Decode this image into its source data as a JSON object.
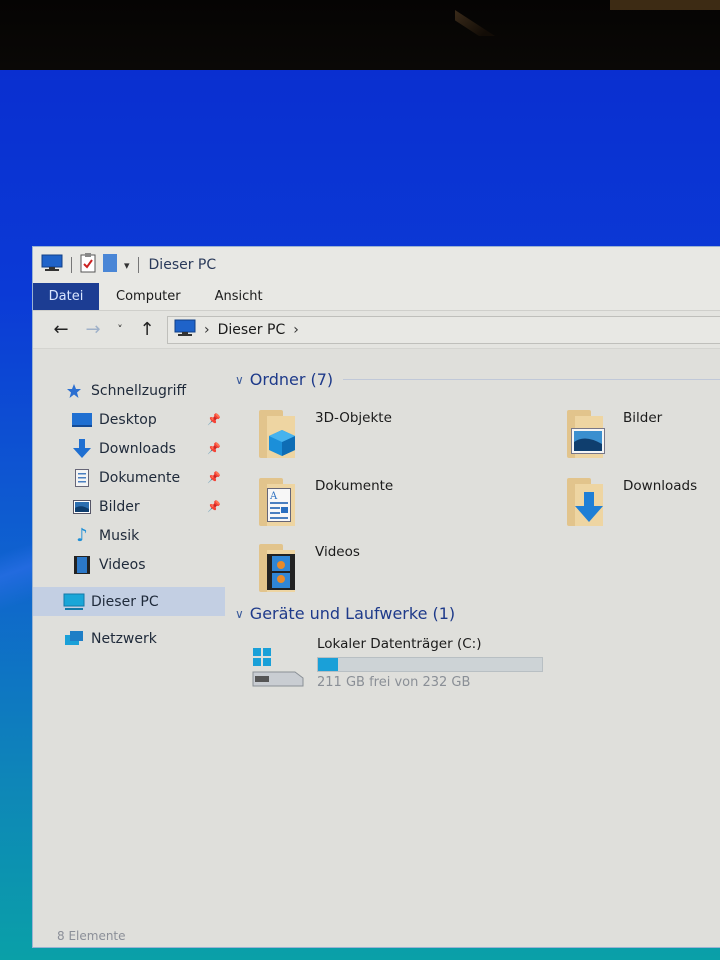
{
  "window": {
    "title": "Dieser PC",
    "quick_access_toolbar": [
      "computer-icon",
      "properties-icon",
      "new-folder-icon",
      "customize-dropdown-icon"
    ]
  },
  "ribbon": {
    "tabs": [
      {
        "label": "Datei",
        "active": true
      },
      {
        "label": "Computer",
        "active": false
      },
      {
        "label": "Ansicht",
        "active": false
      }
    ]
  },
  "address_bar": {
    "back": "←",
    "forward": "→",
    "recent": "˅",
    "up": "↑",
    "path": [
      "Dieser PC"
    ]
  },
  "nav_pane": {
    "quick_access": {
      "label": "Schnellzugriff",
      "icon": "star-icon"
    },
    "items": [
      {
        "label": "Desktop",
        "icon": "desktop-icon",
        "pinned": true
      },
      {
        "label": "Downloads",
        "icon": "download-icon",
        "pinned": true
      },
      {
        "label": "Dokumente",
        "icon": "document-icon",
        "pinned": true
      },
      {
        "label": "Bilder",
        "icon": "pictures-icon",
        "pinned": true
      },
      {
        "label": "Musik",
        "icon": "music-icon",
        "pinned": false
      },
      {
        "label": "Videos",
        "icon": "videos-icon",
        "pinned": false
      }
    ],
    "this_pc": {
      "label": "Dieser PC",
      "icon": "computer-icon",
      "selected": true
    },
    "network": {
      "label": "Netzwerk",
      "icon": "network-icon"
    }
  },
  "main": {
    "folders_group": {
      "title": "Ordner (7)",
      "items": [
        {
          "label": "3D-Objekte",
          "overlay": "cube-icon"
        },
        {
          "label": "Bilder",
          "overlay": "picture-icon"
        },
        {
          "label": "Dokumente",
          "overlay": "document-icon"
        },
        {
          "label": "Downloads",
          "overlay": "download-arrow-icon"
        },
        {
          "label": "Videos",
          "overlay": "film-icon"
        }
      ]
    },
    "drives_group": {
      "title": "Geräte und Laufwerke (1)",
      "items": [
        {
          "label": "Lokaler Datenträger (C:)",
          "free_text": "211 GB frei von 232 GB",
          "free_gb": 211,
          "total_gb": 232,
          "used_fraction": 0.09,
          "bar_color": "#1aa0d8"
        }
      ]
    }
  },
  "status_bar": {
    "text": "8 Elemente"
  },
  "colors": {
    "file_tab": "#1c3d93",
    "group_header": "#1e3a8a",
    "selection": "#c3cfe3"
  }
}
